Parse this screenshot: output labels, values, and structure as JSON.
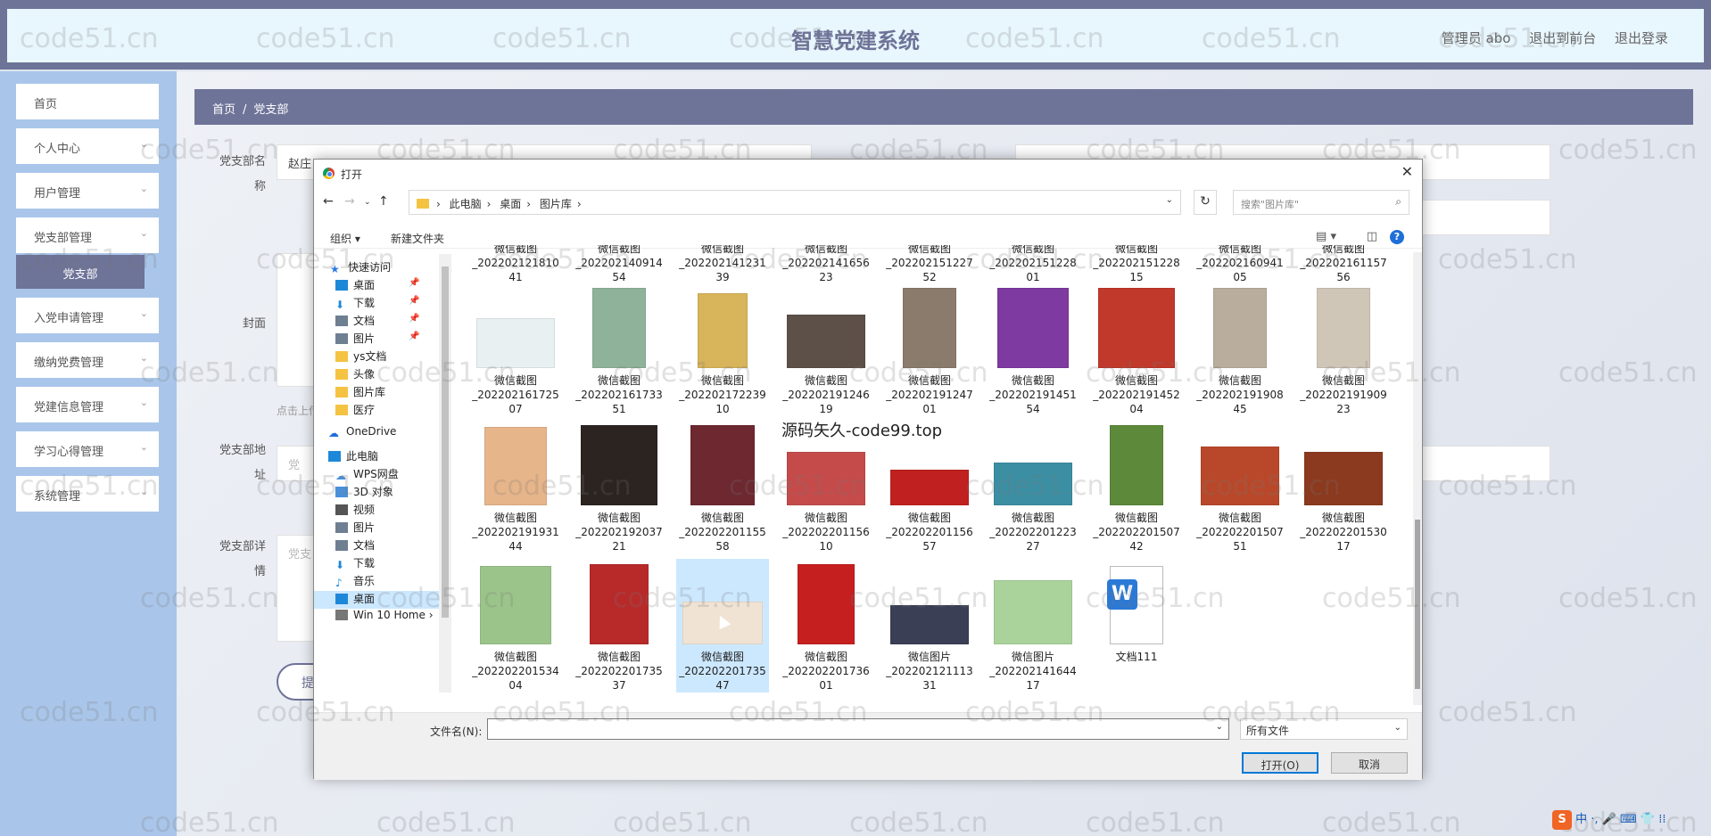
{
  "header": {
    "title": "智慧党建系统",
    "admin": "管理员 abo",
    "front": "退出到前台",
    "logout": "退出登录"
  },
  "sidebar": {
    "items": [
      {
        "label": "首页"
      },
      {
        "label": "个人中心"
      },
      {
        "label": "用户管理"
      },
      {
        "label": "党支部管理"
      },
      {
        "label": "入党申请管理"
      },
      {
        "label": "缴纳党费管理"
      },
      {
        "label": "党建信息管理"
      },
      {
        "label": "学习心得管理"
      },
      {
        "label": "系统管理"
      }
    ],
    "sub_active": "党支部"
  },
  "breadcrumb": {
    "home": "首页",
    "sep": "/",
    "current": "党支部"
  },
  "form": {
    "name_label": "党支部名称",
    "name_value": "赵庄",
    "cover_label": "封面",
    "upload_hint": "点击上传",
    "addr_label": "党支部地址",
    "addr_placeholder": "党",
    "detail_label": "党支部详情",
    "detail_placeholder": "党支",
    "submit_label": "提"
  },
  "watermark": "code51.cn",
  "dialog": {
    "title": "打开",
    "path": [
      "此电脑",
      "桌面",
      "图片库"
    ],
    "search_placeholder": "搜索\"图片库\"",
    "organize": "组织 ▾",
    "new_folder": "新建文件夹",
    "nav": [
      {
        "label": "快速访问",
        "icon": "star",
        "color": "#2b78e4"
      },
      {
        "label": "桌面",
        "icon": "desktop",
        "color": "#1e88d8",
        "pin": true
      },
      {
        "label": "下载",
        "icon": "download",
        "color": "#1e88d8",
        "pin": true
      },
      {
        "label": "文档",
        "icon": "doc",
        "color": "#6f7f92",
        "pin": true
      },
      {
        "label": "图片",
        "icon": "pic",
        "color": "#6f7f92",
        "pin": true
      },
      {
        "label": "ys文档",
        "icon": "folder",
        "color": "#f5c342"
      },
      {
        "label": "头像",
        "icon": "folder",
        "color": "#f5c342"
      },
      {
        "label": "图片库",
        "icon": "folder",
        "color": "#f5c342"
      },
      {
        "label": "医疗",
        "icon": "folder",
        "color": "#f5c342"
      },
      {
        "label": "OneDrive",
        "icon": "cloud",
        "color": "#1e6fd9"
      },
      {
        "label": "此电脑",
        "icon": "pc",
        "color": "#1e88d8"
      },
      {
        "label": "WPS网盘",
        "icon": "cloud",
        "color": "#4a90d9"
      },
      {
        "label": "3D 对象",
        "icon": "cube",
        "color": "#4a90d9"
      },
      {
        "label": "视频",
        "icon": "video",
        "color": "#555"
      },
      {
        "label": "图片",
        "icon": "pic",
        "color": "#6f7f92"
      },
      {
        "label": "文档",
        "icon": "doc",
        "color": "#6f7f92"
      },
      {
        "label": "下载",
        "icon": "download",
        "color": "#1e88d8"
      },
      {
        "label": "音乐",
        "icon": "music",
        "color": "#1e88d8"
      },
      {
        "label": "桌面",
        "icon": "desktop",
        "color": "#1e88d8",
        "selected": true
      },
      {
        "label": "Win 10 Home ›",
        "icon": "drive",
        "color": "#777"
      }
    ],
    "files_row0": [
      "_202202121810 41",
      "_202202140914 54",
      "_202202141231 39",
      "_202202141656 23",
      "_202202151227 52",
      "_202202151228 01",
      "_202202151228 15",
      "_202202160941 05",
      "_202202161157 56"
    ],
    "files": [
      {
        "name1": "微信截图",
        "name2": "_202202161725 07",
        "color": "#e8f0f2",
        "w": 88,
        "h": 56
      },
      {
        "name1": "微信截图",
        "name2": "_202202161733 51",
        "color": "#8fb39a",
        "w": 60,
        "h": 90
      },
      {
        "name1": "微信截图",
        "name2": "_202202172239 10",
        "color": "#d8b45a",
        "w": 56,
        "h": 84
      },
      {
        "name1": "微信截图",
        "name2": "_202202191246 19",
        "color": "#5d5048",
        "w": 88,
        "h": 60
      },
      {
        "name1": "微信截图",
        "name2": "_202202191247 01",
        "color": "#8a7b6c",
        "w": 60,
        "h": 90
      },
      {
        "name1": "微信截图",
        "name2": "_202202191451 54",
        "color": "#7e3aa0",
        "w": 80,
        "h": 90
      },
      {
        "name1": "微信截图",
        "name2": "_202202191452 04",
        "color": "#c0392b",
        "w": 86,
        "h": 90
      },
      {
        "name1": "微信截图",
        "name2": "_202202191908 45",
        "color": "#b9ad9e",
        "w": 60,
        "h": 90
      },
      {
        "name1": "微信截图",
        "name2": "_202202191909 23",
        "color": "#cfc6b8",
        "w": 60,
        "h": 90
      },
      {
        "name1": "微信截图",
        "name2": "_202202191931 44",
        "color": "#e7b58a",
        "w": 70,
        "h": 88
      },
      {
        "name1": "微信截图",
        "name2": "_202202192037 21",
        "color": "#2b2421",
        "w": 86,
        "h": 90
      },
      {
        "name1": "微信截图",
        "name2": "_202202201155 58",
        "color": "#6d2830",
        "w": 72,
        "h": 90
      },
      {
        "name1": "微信截图",
        "name2": "_202202201156 10",
        "color": "#c54b4b",
        "w": 88,
        "h": 60
      },
      {
        "name1": "微信截图",
        "name2": "_202202201156 57",
        "color": "#c0201f",
        "w": 88,
        "h": 40
      },
      {
        "name1": "微信截图",
        "name2": "_202202201223 27",
        "color": "#3c8fa3",
        "w": 88,
        "h": 48
      },
      {
        "name1": "微信截图",
        "name2": "_202202201507 42",
        "color": "#5c8a3a",
        "w": 60,
        "h": 90
      },
      {
        "name1": "微信截图",
        "name2": "_202202201507 51",
        "color": "#b9482a",
        "w": 88,
        "h": 66
      },
      {
        "name1": "微信截图",
        "name2": "_202202201530 17",
        "color": "#8b3a1f",
        "w": 88,
        "h": 60
      },
      {
        "name1": "微信截图",
        "name2": "_202202201534 04",
        "color": "#9bc48a",
        "w": 80,
        "h": 88
      },
      {
        "name1": "微信截图",
        "name2": "_202202201735 37",
        "color": "#b82a2a",
        "w": 66,
        "h": 90
      },
      {
        "name1": "微信截图",
        "name2": "_202202201735 47",
        "color": "#f1e3d4",
        "w": 90,
        "h": 48,
        "selected": true
      },
      {
        "name1": "微信截图",
        "name2": "_202202201736 01",
        "color": "#c51f1f",
        "w": 64,
        "h": 90
      },
      {
        "name1": "微信图片",
        "name2": "_202202121113 31",
        "color": "#3a3f55",
        "w": 88,
        "h": 44
      },
      {
        "name1": "微信图片",
        "name2": "_202202141644 17",
        "color": "#a9d39a",
        "w": 88,
        "h": 72
      },
      {
        "name1": "文档111",
        "name2": "",
        "color": "doc",
        "w": 60,
        "h": 88
      }
    ],
    "overlay": "源码矢久-code99.top",
    "filename_label": "文件名(N):",
    "filetype": "所有文件",
    "open_btn": "打开(O)",
    "cancel_btn": "取消"
  },
  "ime": {
    "logo": "S",
    "text": "中 ·, 🎤 ⌨ 👕 ⁞⁞"
  }
}
